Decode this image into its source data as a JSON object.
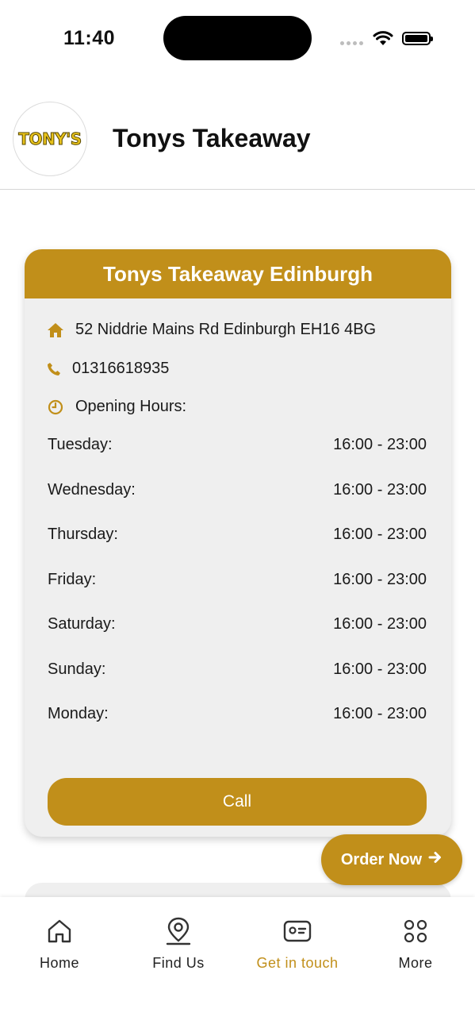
{
  "status": {
    "time": "11:40"
  },
  "header": {
    "logo_text": "TONY'S",
    "title": "Tonys Takeaway"
  },
  "card": {
    "title": "Tonys Takeaway Edinburgh",
    "address": "52 Niddrie Mains Rd Edinburgh EH16 4BG",
    "phone": "01316618935",
    "hours_label": "Opening Hours:",
    "hours": [
      {
        "day": "Tuesday:",
        "time": "16:00 - 23:00"
      },
      {
        "day": "Wednesday:",
        "time": "16:00 - 23:00"
      },
      {
        "day": "Thursday:",
        "time": "16:00 - 23:00"
      },
      {
        "day": "Friday:",
        "time": "16:00 - 23:00"
      },
      {
        "day": "Saturday:",
        "time": "16:00 - 23:00"
      },
      {
        "day": "Sunday:",
        "time": "16:00 - 23:00"
      },
      {
        "day": "Monday:",
        "time": "16:00 - 23:00"
      }
    ],
    "call_label": "Call"
  },
  "order_button": {
    "label": "Order Now"
  },
  "tabs": [
    {
      "label": "Home",
      "icon": "home-icon"
    },
    {
      "label": "Find Us",
      "icon": "location-pin-icon"
    },
    {
      "label": "Get in touch",
      "icon": "contact-card-icon",
      "active": true
    },
    {
      "label": "More",
      "icon": "grid-icon"
    }
  ],
  "colors": {
    "accent": "#c18f1a",
    "card_bg": "#efefef",
    "text": "#111111"
  }
}
